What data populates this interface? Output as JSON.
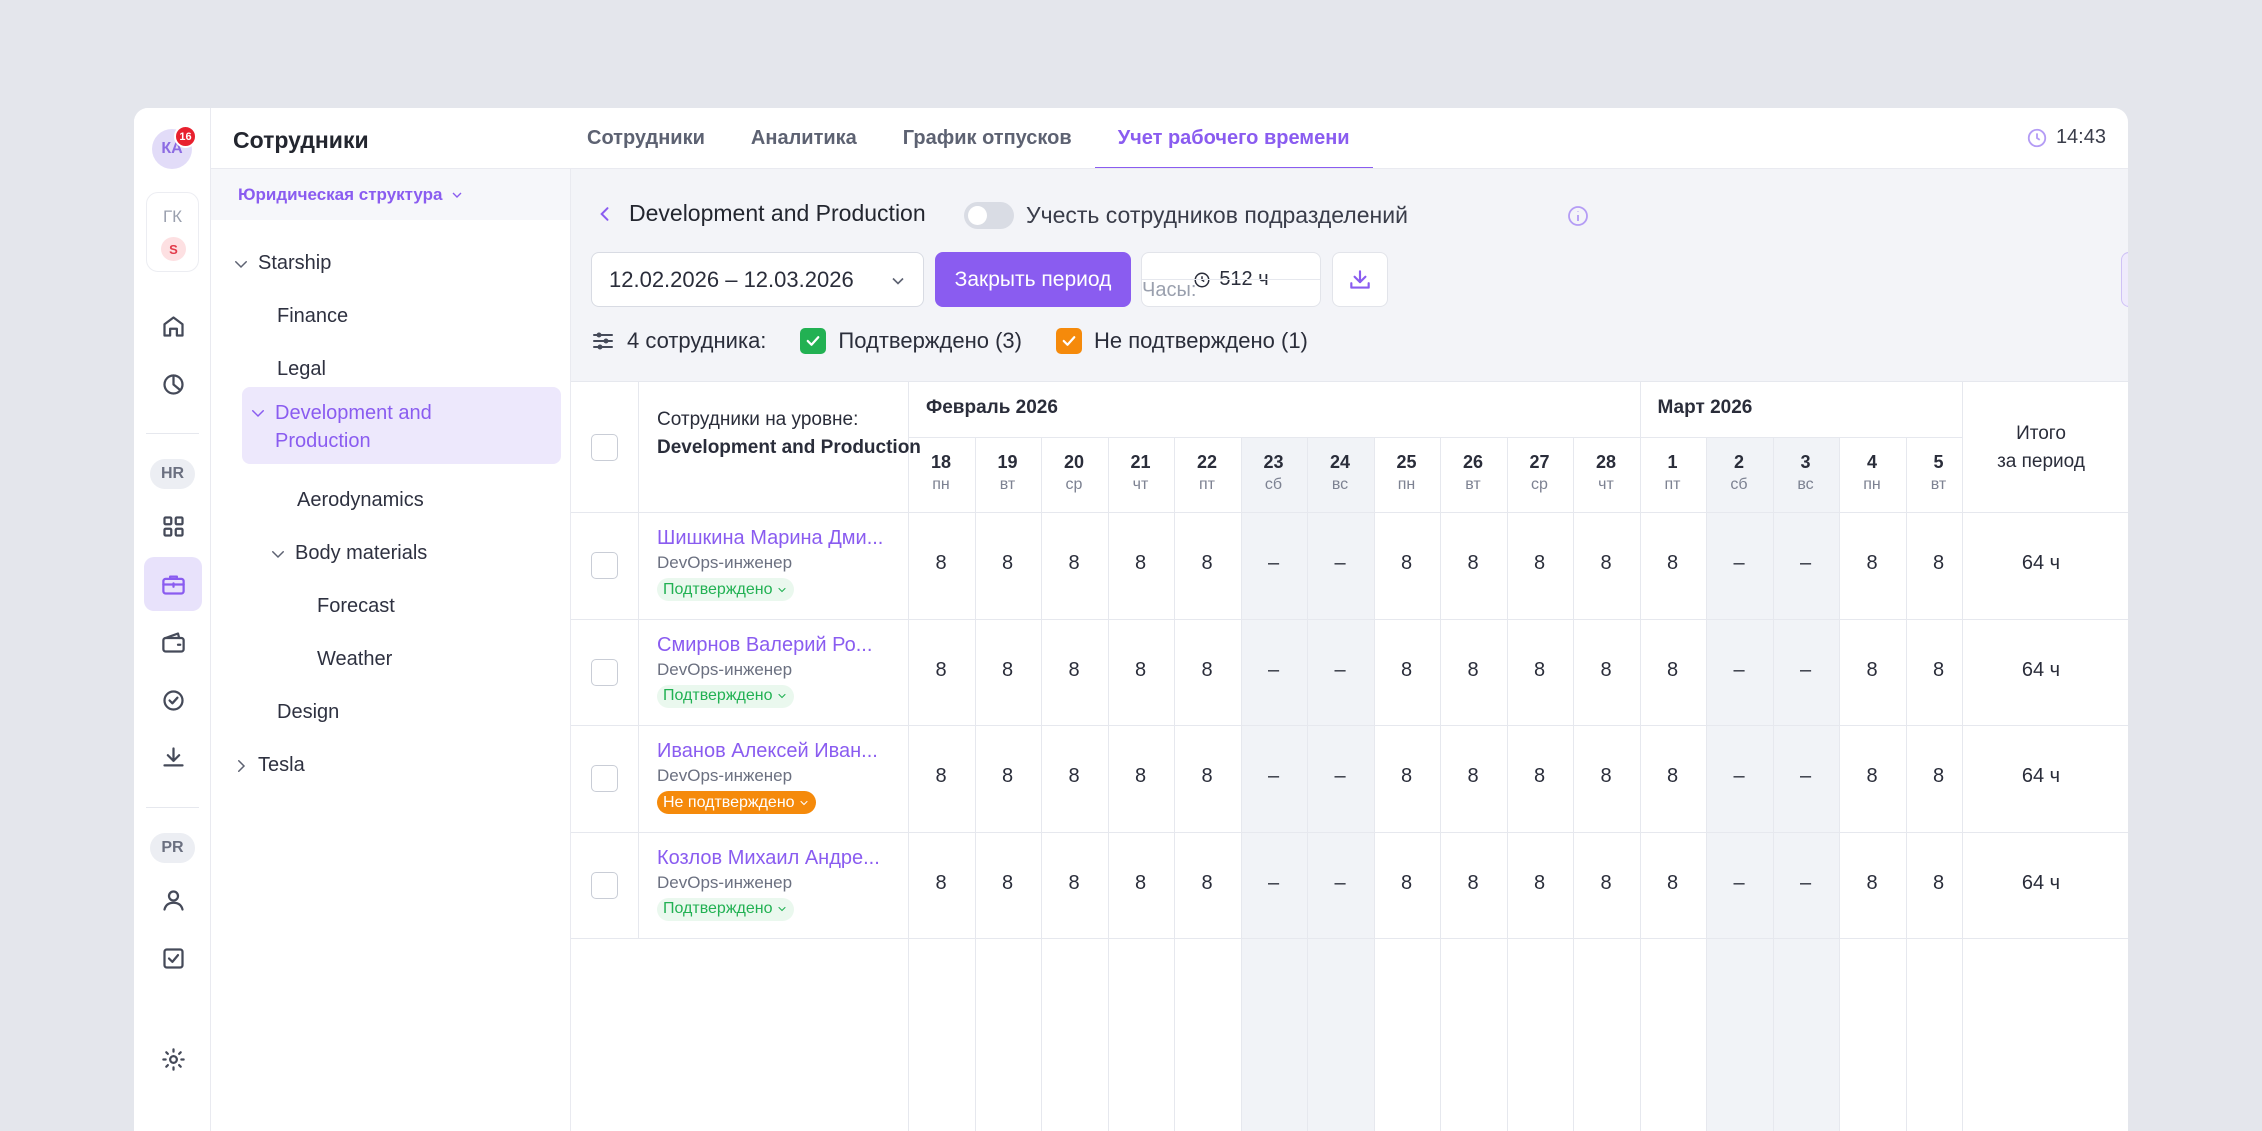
{
  "app": {
    "title": "Сотрудники",
    "time": "14:43"
  },
  "user": {
    "initials": "КА",
    "notifications": "16"
  },
  "org": {
    "code": "ГК",
    "badge": "S"
  },
  "rail": {
    "hr": "HR",
    "pr": "PR"
  },
  "tabs": [
    {
      "label": "Сотрудники",
      "active": false
    },
    {
      "label": "Аналитика",
      "active": false
    },
    {
      "label": "График отпусков",
      "active": false
    },
    {
      "label": "Учет рабочего времени",
      "active": true
    }
  ],
  "tree": {
    "structure_label": "Юридическая структура",
    "nodes": [
      "Starship",
      "Finance",
      "Legal",
      "Development and Production",
      "Aerodynamics",
      "Body materials",
      "Forecast",
      "Weather",
      "Design",
      "Tesla"
    ]
  },
  "toolbar": {
    "breadcrumb": "Development and Production",
    "include_sub_label": "Учесть сотрудников подразделений",
    "date_range": "12.02.2026 – 12.03.2026",
    "close_period": "Закрыть период",
    "hours_label": "Часы:",
    "hours_value": "512 ч"
  },
  "summary": {
    "count": "4 сотрудника:",
    "confirmed": "Подтверждено (3)",
    "unconfirmed": "Не подтверждено (1)"
  },
  "colors": {
    "accent": "#8a5cf0",
    "confirmed": "#22b153",
    "unconfirmed": "#f58a0b"
  },
  "table": {
    "employees_header": "Сотрудники на уровне:",
    "employees_level": "Development and Production",
    "months": [
      "Февраль 2026",
      "Март 2026"
    ],
    "total_header_1": "Итого",
    "total_header_2": "за период",
    "days": [
      {
        "n": "18",
        "w": "пн",
        "weekend": false
      },
      {
        "n": "19",
        "w": "вт",
        "weekend": false
      },
      {
        "n": "20",
        "w": "ср",
        "weekend": false
      },
      {
        "n": "21",
        "w": "чт",
        "weekend": false
      },
      {
        "n": "22",
        "w": "пт",
        "weekend": false
      },
      {
        "n": "23",
        "w": "сб",
        "weekend": true
      },
      {
        "n": "24",
        "w": "вс",
        "weekend": true
      },
      {
        "n": "25",
        "w": "пн",
        "weekend": false
      },
      {
        "n": "26",
        "w": "вт",
        "weekend": false
      },
      {
        "n": "27",
        "w": "ср",
        "weekend": false
      },
      {
        "n": "28",
        "w": "чт",
        "weekend": false
      },
      {
        "n": "1",
        "w": "пт",
        "weekend": false
      },
      {
        "n": "2",
        "w": "сб",
        "weekend": true
      },
      {
        "n": "3",
        "w": "вс",
        "weekend": true
      },
      {
        "n": "4",
        "w": "пн",
        "weekend": false
      },
      {
        "n": "5",
        "w": "вт",
        "weekend": false
      }
    ],
    "rows": [
      {
        "name": "Шишкина Марина Дми...",
        "role": "DevOps-инженер",
        "status": "Подтверждено",
        "confirmed": true,
        "hours": [
          "8",
          "8",
          "8",
          "8",
          "8",
          "–",
          "–",
          "8",
          "8",
          "8",
          "8",
          "8",
          "–",
          "–",
          "8",
          "8"
        ],
        "total": "64 ч"
      },
      {
        "name": "Смирнов Валерий Ро...",
        "role": "DevOps-инженер",
        "status": "Подтверждено",
        "confirmed": true,
        "hours": [
          "8",
          "8",
          "8",
          "8",
          "8",
          "–",
          "–",
          "8",
          "8",
          "8",
          "8",
          "8",
          "–",
          "–",
          "8",
          "8"
        ],
        "total": "64 ч"
      },
      {
        "name": "Иванов Алексей Иван...",
        "role": "DevOps-инженер",
        "status": "Не подтверждено",
        "confirmed": false,
        "hours": [
          "8",
          "8",
          "8",
          "8",
          "8",
          "–",
          "–",
          "8",
          "8",
          "8",
          "8",
          "8",
          "–",
          "–",
          "8",
          "8"
        ],
        "total": "64 ч"
      },
      {
        "name": "Козлов Михаил Андре...",
        "role": "DevOps-инженер",
        "status": "Подтверждено",
        "confirmed": true,
        "hours": [
          "8",
          "8",
          "8",
          "8",
          "8",
          "–",
          "–",
          "8",
          "8",
          "8",
          "8",
          "8",
          "–",
          "–",
          "8",
          "8"
        ],
        "total": "64 ч"
      }
    ]
  }
}
